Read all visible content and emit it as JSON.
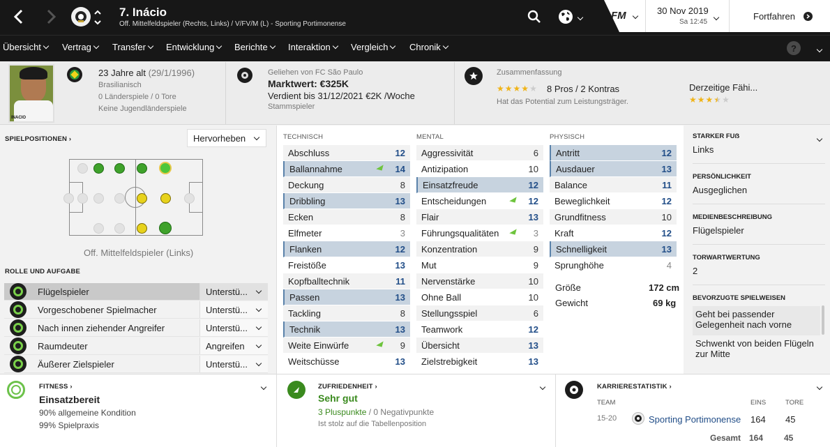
{
  "header": {
    "player_name": "7. Inácio",
    "player_sub": "Off. Mittelfeldspieler (Rechts, Links) / V/FV/M (L) - Sporting Portimonense",
    "date": "30 Nov 2019",
    "time": "Sa 12:45",
    "continue_label": "Fortfahren",
    "fm_logo": "FM"
  },
  "nav": [
    "Übersicht",
    "Vertrag",
    "Transfer",
    "Entwicklung",
    "Berichte",
    "Interaktion",
    "Vergleich",
    "Chronik"
  ],
  "profile": {
    "age": "23 Jahre alt",
    "dob": "(29/1/1996)",
    "nationality": "Brasilianisch",
    "caps": "0 Länderspiele / 0 Tore",
    "youth": "Keine Jugendländerspiele",
    "photo_label": "INACIO"
  },
  "contract": {
    "loan": "Geliehen von FC São Paulo",
    "value": "Marktwert: €325K",
    "earns": "Verdient bis 31/12/2021 €2K /Woche",
    "status": "Stammspieler"
  },
  "summary": {
    "title": "Zusammenfassung",
    "pros": "8 Pros / 2 Kontras",
    "potential": "Hat das Potential zum Leistungsträger.",
    "current_label": "Derzeitige Fähi...",
    "potential_stars": 4,
    "current_stars": 3.5
  },
  "positions": {
    "title": "SPIELPOSITIONEN",
    "highlight": "Hervorheben",
    "caption": "Off. Mittelfeldspieler (Links)"
  },
  "roles": {
    "title": "ROLLE UND AUFGABE",
    "items": [
      {
        "name": "Flügelspieler",
        "duty": "Unterstü..."
      },
      {
        "name": "Vorgeschobener Spielmacher",
        "duty": "Unterstü..."
      },
      {
        "name": "Nach innen ziehender Angreifer",
        "duty": "Unterstü..."
      },
      {
        "name": "Raumdeuter",
        "duty": "Angreifen"
      },
      {
        "name": "Äußerer Zielspieler",
        "duty": "Unterstü..."
      }
    ]
  },
  "attributes": {
    "technical_title": "TECHNISCH",
    "mental_title": "MENTAL",
    "physical_title": "PHYSISCH",
    "technical": [
      {
        "name": "Abschluss",
        "value": "12"
      },
      {
        "name": "Ballannahme",
        "value": "14"
      },
      {
        "name": "Deckung",
        "value": "8"
      },
      {
        "name": "Dribbling",
        "value": "13"
      },
      {
        "name": "Ecken",
        "value": "8"
      },
      {
        "name": "Elfmeter",
        "value": "3"
      },
      {
        "name": "Flanken",
        "value": "12"
      },
      {
        "name": "Freistöße",
        "value": "13"
      },
      {
        "name": "Kopfballtechnik",
        "value": "11"
      },
      {
        "name": "Passen",
        "value": "13"
      },
      {
        "name": "Tackling",
        "value": "8"
      },
      {
        "name": "Technik",
        "value": "13"
      },
      {
        "name": "Weite Einwürfe",
        "value": "9"
      },
      {
        "name": "Weitschüsse",
        "value": "13"
      }
    ],
    "mental": [
      {
        "name": "Aggressivität",
        "value": "6"
      },
      {
        "name": "Antizipation",
        "value": "10"
      },
      {
        "name": "Einsatzfreude",
        "value": "12"
      },
      {
        "name": "Entscheidungen",
        "value": "12"
      },
      {
        "name": "Flair",
        "value": "13"
      },
      {
        "name": "Führungsqualitäten",
        "value": "3"
      },
      {
        "name": "Konzentration",
        "value": "9"
      },
      {
        "name": "Mut",
        "value": "9"
      },
      {
        "name": "Nervenstärke",
        "value": "10"
      },
      {
        "name": "Ohne Ball",
        "value": "10"
      },
      {
        "name": "Stellungsspiel",
        "value": "6"
      },
      {
        "name": "Teamwork",
        "value": "12"
      },
      {
        "name": "Übersicht",
        "value": "13"
      },
      {
        "name": "Zielstrebigkeit",
        "value": "13"
      }
    ],
    "physical": [
      {
        "name": "Antritt",
        "value": "12"
      },
      {
        "name": "Ausdauer",
        "value": "13"
      },
      {
        "name": "Balance",
        "value": "11"
      },
      {
        "name": "Beweglichkeit",
        "value": "12"
      },
      {
        "name": "Grundfitness",
        "value": "10"
      },
      {
        "name": "Kraft",
        "value": "12"
      },
      {
        "name": "Schnelligkeit",
        "value": "13"
      },
      {
        "name": "Sprunghöhe",
        "value": "4"
      }
    ],
    "height_label": "Größe",
    "height": "172 cm",
    "weight_label": "Gewicht",
    "weight": "69 kg"
  },
  "info": {
    "foot_label": "STARKER FUẞ",
    "foot": "Links",
    "personality_label": "PERSÖNLICHKEIT",
    "personality": "Ausgeglichen",
    "media_label": "MEDIENBESCHREIBUNG",
    "media": "Flügelspieler",
    "gk_label": "TORWARTWERTUNG",
    "gk": "2",
    "pref_label": "BEVORZUGTE SPIELWEISEN",
    "pref_1_line1": "Geht bei passender",
    "pref_1_line2": "Gelegenheit nach vorne",
    "pref_2_line1": "Schwenkt von beiden Flügeln",
    "pref_2_line2": "zur Mitte"
  },
  "fitness": {
    "title": "FITNESS",
    "status": "Einsatzbereit",
    "line1": "90% allgemeine Kondition",
    "line2": "99% Spielpraxis"
  },
  "happiness": {
    "title": "ZUFRIEDENHEIT",
    "status": "Sehr gut",
    "plus": "3 Pluspunkte",
    "sep": "/",
    "minus": "0 Negativpunkte",
    "note": "Ist stolz auf die Tabellenposition"
  },
  "career": {
    "title": "KARRIERESTATISTIK",
    "col_team": "TEAM",
    "col_apps": "EINS",
    "col_goals": "TORE",
    "season": "15-20",
    "team": "Sporting Portimonense",
    "apps": "164",
    "goals": "45",
    "total_label": "Gesamt",
    "total_apps": "164",
    "total_goals": "45"
  },
  "colors": {
    "accent": "#224e88",
    "green": "#3a8a1e",
    "highlight_row": "#c7d3df"
  }
}
